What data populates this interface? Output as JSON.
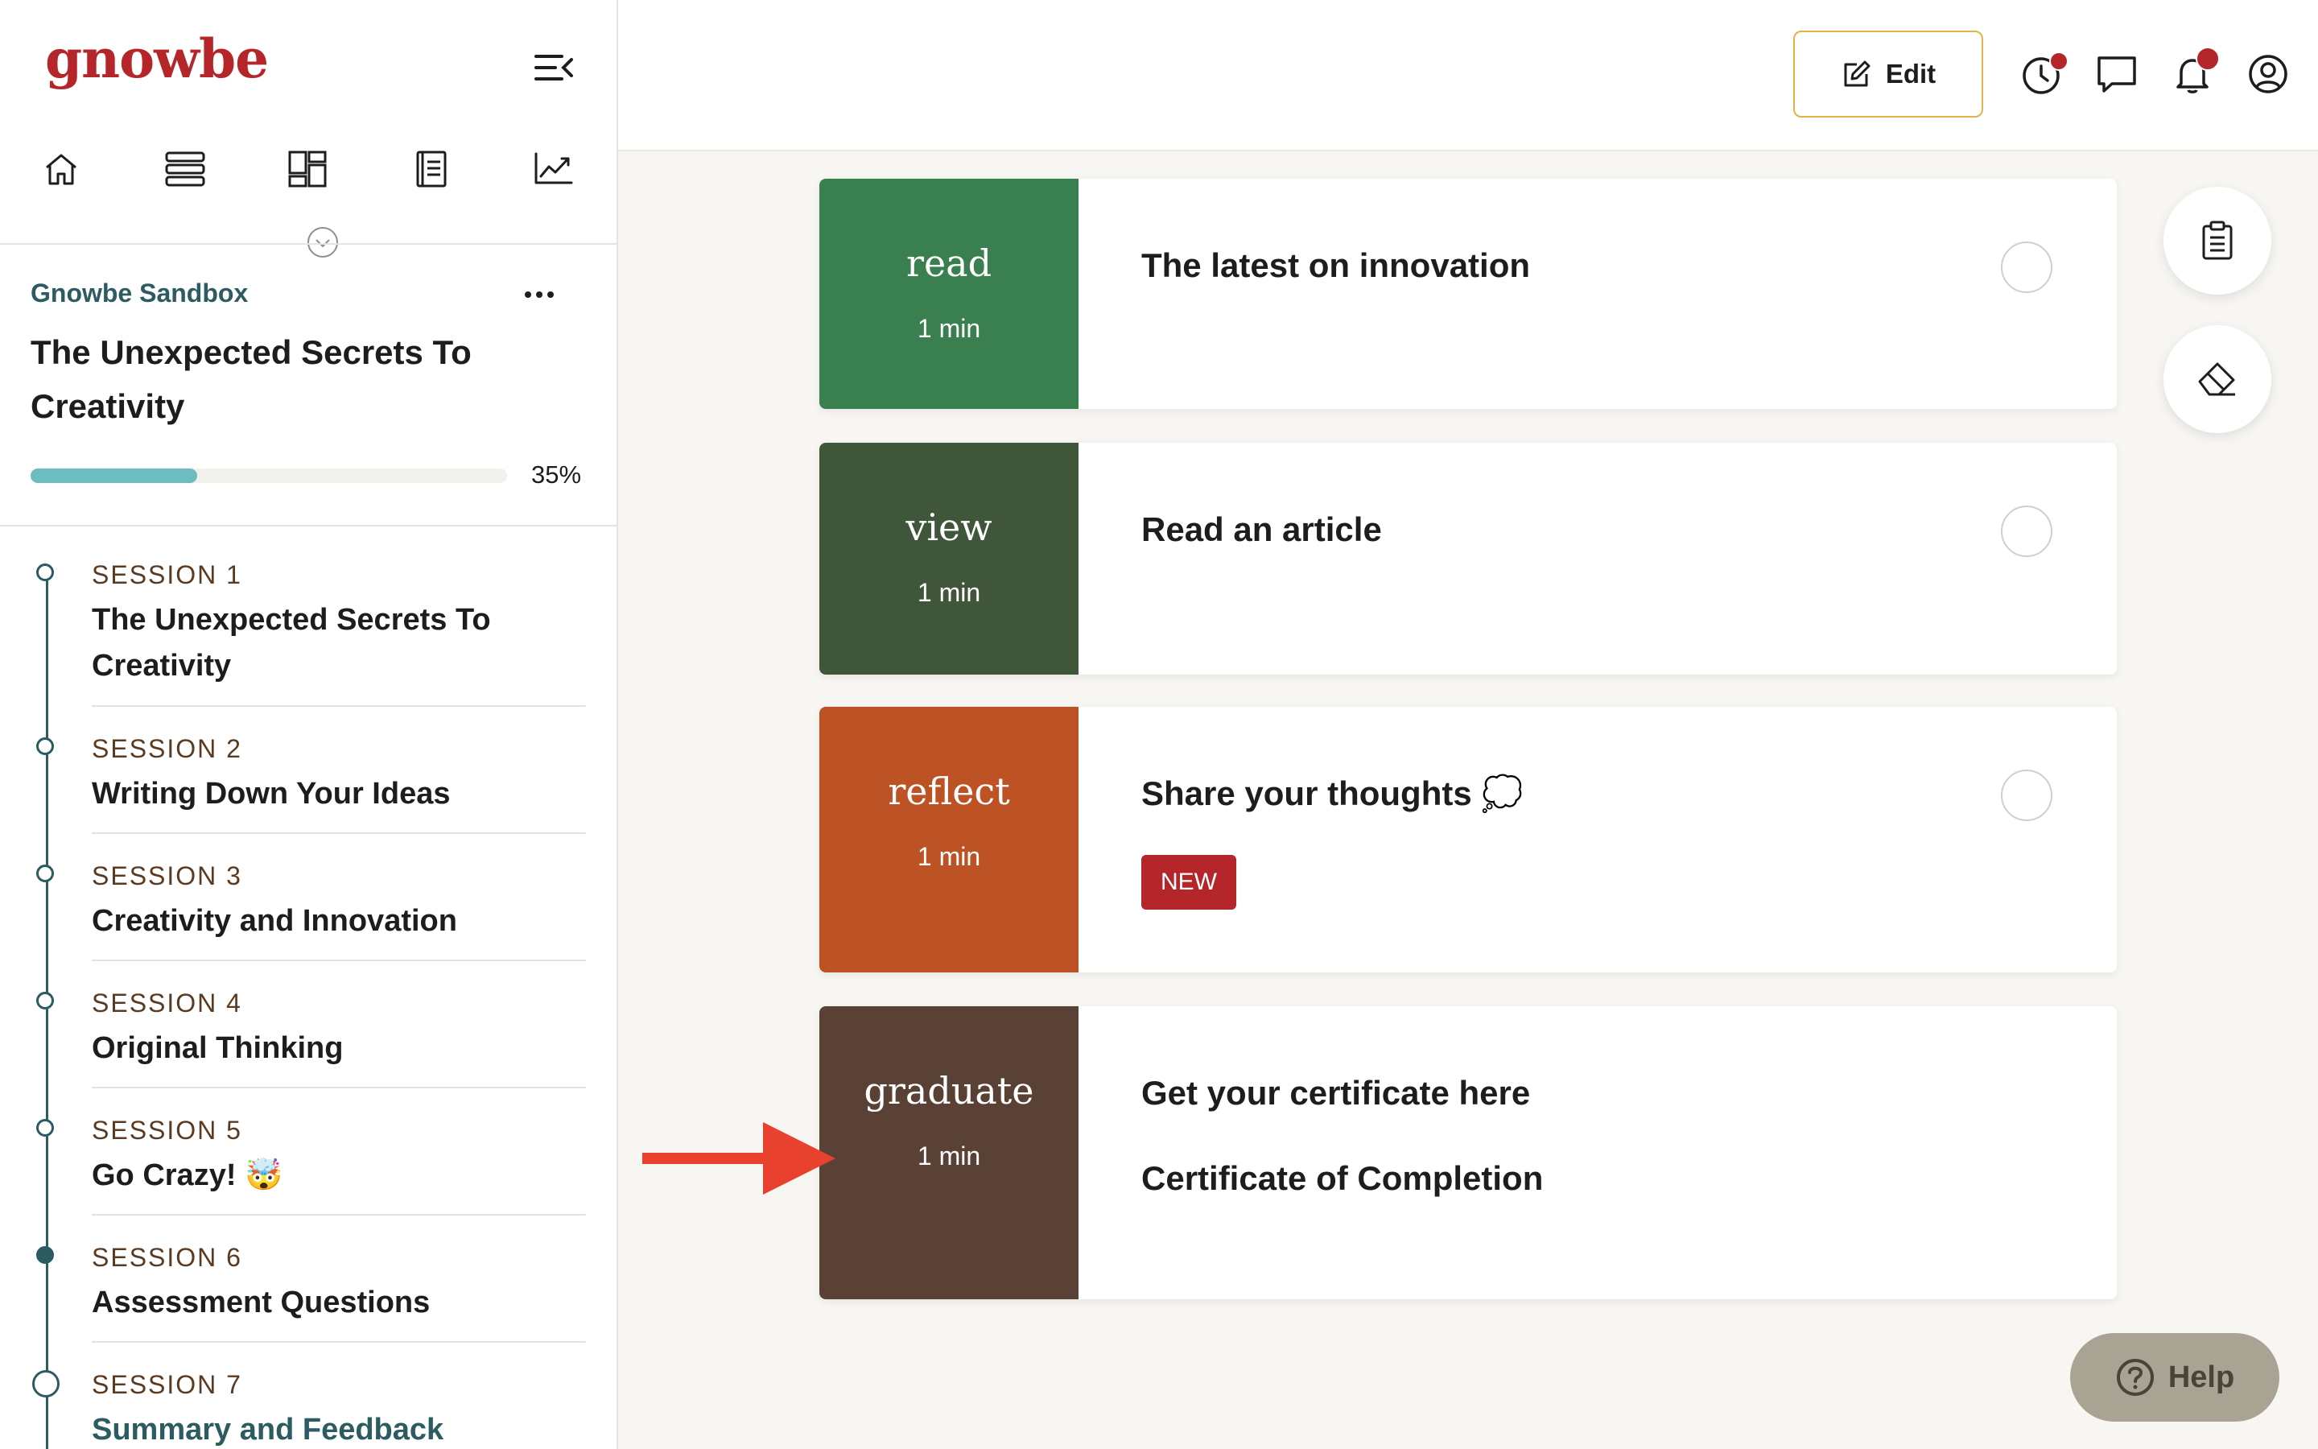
{
  "app": {
    "logo": "gnowbe"
  },
  "sidebar": {
    "org_name": "Gnowbe Sandbox",
    "course_title": "The Unexpected Secrets To Creativity",
    "progress": {
      "percent": 35,
      "label": "35%"
    },
    "nav": [
      {
        "icon": "home-icon"
      },
      {
        "icon": "sessions-list-icon"
      },
      {
        "icon": "dashboard-icon"
      },
      {
        "icon": "book-icon"
      },
      {
        "icon": "analytics-icon"
      }
    ],
    "sessions": [
      {
        "num": "SESSION 1",
        "name": "The Unexpected Secrets To Creativity",
        "state": "open"
      },
      {
        "num": "SESSION 2",
        "name": "Writing Down Your Ideas",
        "state": "open"
      },
      {
        "num": "SESSION 3",
        "name": "Creativity and Innovation",
        "state": "open"
      },
      {
        "num": "SESSION 4",
        "name": "Original Thinking",
        "state": "open"
      },
      {
        "num": "SESSION 5",
        "name": "Go Crazy! 🤯",
        "state": "open"
      },
      {
        "num": "SESSION 6",
        "name": "Assessment Questions",
        "state": "current"
      },
      {
        "num": "SESSION 7",
        "name": "Summary and Feedback",
        "state": "next"
      }
    ]
  },
  "header": {
    "edit_label": "Edit",
    "icons": [
      "history-icon",
      "chat-icon",
      "bell-icon",
      "profile-icon"
    ]
  },
  "cards": [
    {
      "type": "read",
      "duration": "1 min",
      "title": "The latest on innovation",
      "color": "#3a7f4f"
    },
    {
      "type": "view",
      "duration": "1 min",
      "title": "Read an article",
      "color": "#3f563a"
    },
    {
      "type": "reflect",
      "duration": "1 min",
      "title": "Share your thoughts 💭",
      "badge": "NEW",
      "color": "#bd5224"
    },
    {
      "type": "graduate",
      "duration": "1 min",
      "title": "Get your certificate here",
      "subtitle": "Certificate of Completion",
      "color": "#5a4136"
    }
  ],
  "help": {
    "label": "Help"
  },
  "colors": {
    "accent": "#b5262a",
    "teal": "#2c5b62",
    "progress": "#6cbcc0",
    "edit_border": "#e3b34a",
    "arrow": "#e8412e"
  }
}
